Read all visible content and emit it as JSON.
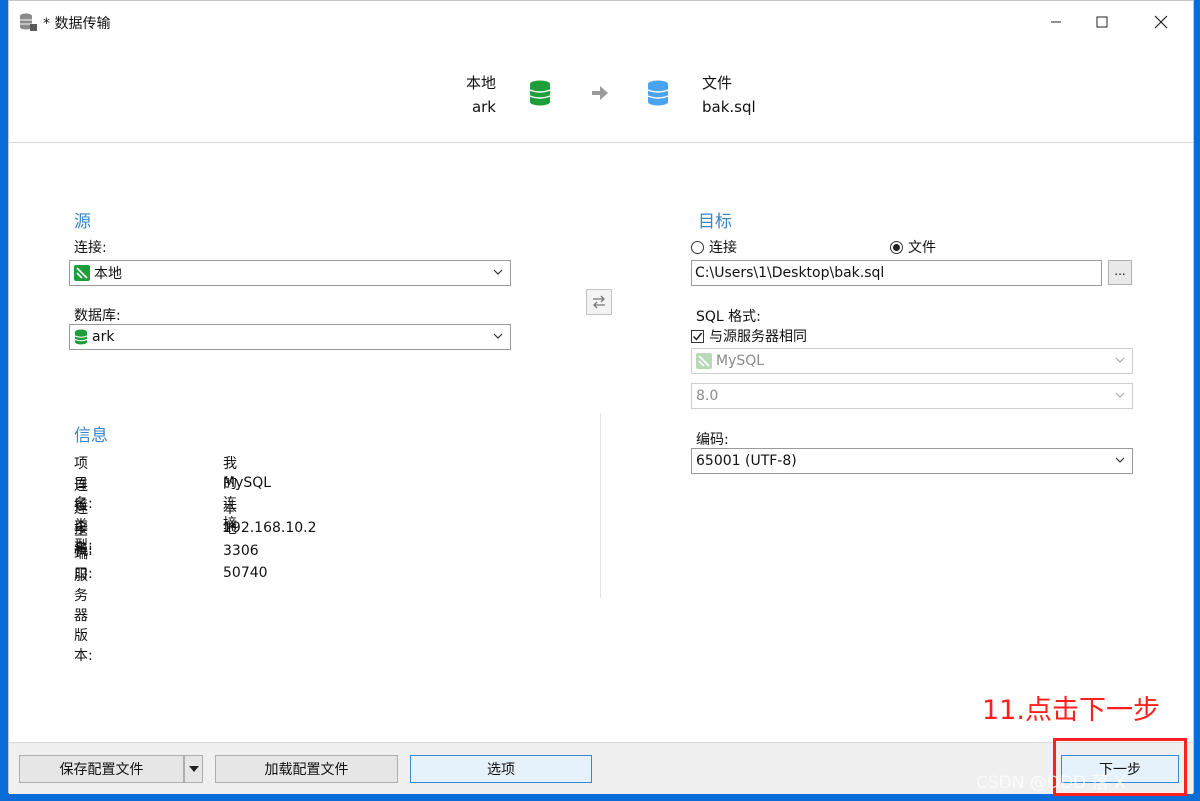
{
  "window": {
    "title": "* 数据传输"
  },
  "header": {
    "source": {
      "type": "本地",
      "name": "ark"
    },
    "target": {
      "type": "文件",
      "name": "bak.sql"
    }
  },
  "source": {
    "title": "源",
    "connection_label": "连接:",
    "connection_value": "本地",
    "database_label": "数据库:",
    "database_value": "ark"
  },
  "info": {
    "title": "信息",
    "rows": [
      {
        "key": "项目名:",
        "value": "我的连接"
      },
      {
        "key": "连接类型:",
        "value": "MySQL"
      },
      {
        "key": "连接名:",
        "value": "本地"
      },
      {
        "key": "主机:",
        "value": "192.168.10.2"
      },
      {
        "key": "端口:",
        "value": "3306"
      },
      {
        "key": "服务器版本:",
        "value": "50740"
      }
    ]
  },
  "target": {
    "title": "目标",
    "radio_connection": "连接",
    "radio_file": "文件",
    "selected": "file",
    "file_path": "C:\\Users\\1\\Desktop\\bak.sql",
    "browse_label": "...",
    "sql_format_label": "SQL 格式:",
    "same_as_source_label": "与源服务器相同",
    "same_as_source_checked": true,
    "format_value": "MySQL",
    "version_value": "8.0",
    "encoding_label": "编码:",
    "encoding_value": "65001 (UTF-8)"
  },
  "footer": {
    "save_config": "保存配置文件",
    "load_config": "加载配置文件",
    "options": "选项",
    "next": "下一步"
  },
  "annotation": {
    "text": "11.点击下一步"
  },
  "watermark": {
    "text": "CSDN @DDD 落 X"
  },
  "colors": {
    "accent": "#3a86c8",
    "annotation": "#ff1f1f",
    "green_db": "#1e9e3a",
    "blue_db": "#4aa3f0"
  }
}
